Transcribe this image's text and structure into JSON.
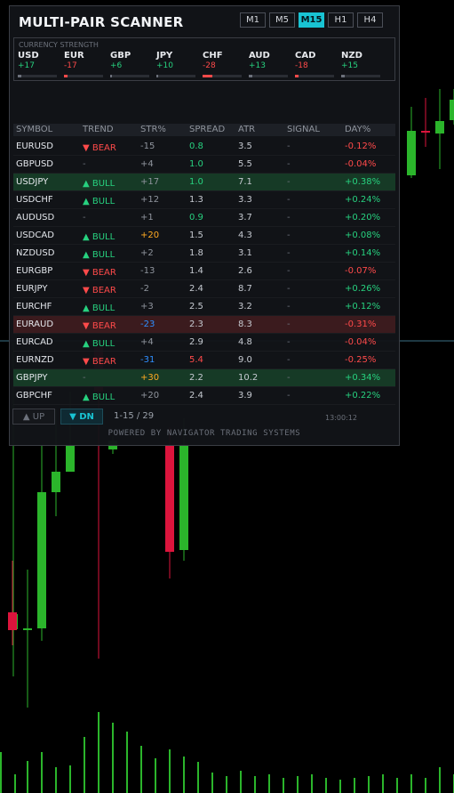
{
  "title": "MULTI-PAIR SCANNER",
  "timeframes": [
    {
      "label": "M1",
      "active": false
    },
    {
      "label": "M5",
      "active": false
    },
    {
      "label": "M15",
      "active": true
    },
    {
      "label": "H1",
      "active": false
    },
    {
      "label": "H4",
      "active": false
    }
  ],
  "currency_strength": {
    "title": "CURRENCY STRENGTH",
    "items": [
      {
        "name": "USD",
        "value": "+17",
        "strength": 0.1,
        "color": "#27d17f"
      },
      {
        "name": "EUR",
        "value": "-17",
        "strength": 0.1,
        "color": "#ff4a4a"
      },
      {
        "name": "GBP",
        "value": "+6",
        "strength": 0.05,
        "color": "#27d17f"
      },
      {
        "name": "JPY",
        "value": "+10",
        "strength": 0.05,
        "color": "#27d17f"
      },
      {
        "name": "CHF",
        "value": "-28",
        "strength": 0.25,
        "color": "#ff4a4a"
      },
      {
        "name": "AUD",
        "value": "+13",
        "strength": 0.1,
        "color": "#27d17f"
      },
      {
        "name": "CAD",
        "value": "-18",
        "strength": 0.1,
        "color": "#ff4a4a"
      },
      {
        "name": "NZD",
        "value": "+15",
        "strength": 0.1,
        "color": "#27d17f"
      }
    ]
  },
  "table": {
    "headers": [
      "SYMBOL",
      "TREND",
      "STR%",
      "SPREAD",
      "ATR",
      "SIGNAL",
      "DAY%"
    ],
    "rows": [
      {
        "symbol": "EURUSD",
        "trend": "▼ BEAR",
        "trend_class": "dn",
        "str": "-15",
        "str_class": "grey",
        "spread": "0.8",
        "spread_class": "green",
        "atr": "3.5",
        "signal": "-",
        "day": "-0.12%",
        "day_class": "red",
        "highlight": ""
      },
      {
        "symbol": "GBPUSD",
        "trend": "-",
        "trend_class": "neu",
        "str": "+4",
        "str_class": "grey",
        "spread": "1.0",
        "spread_class": "green",
        "atr": "5.5",
        "signal": "-",
        "day": "-0.04%",
        "day_class": "red",
        "highlight": ""
      },
      {
        "symbol": "USDJPY",
        "trend": "▲ BULL",
        "trend_class": "up",
        "str": "+17",
        "str_class": "grey",
        "spread": "1.0",
        "spread_class": "green",
        "atr": "7.1",
        "signal": "-",
        "day": "+0.38%",
        "day_class": "green",
        "highlight": "bull"
      },
      {
        "symbol": "USDCHF",
        "trend": "▲ BULL",
        "trend_class": "up",
        "str": "+12",
        "str_class": "grey",
        "spread": "1.3",
        "spread_class": "white",
        "atr": "3.3",
        "signal": "-",
        "day": "+0.24%",
        "day_class": "green",
        "highlight": ""
      },
      {
        "symbol": "AUDUSD",
        "trend": "-",
        "trend_class": "neu",
        "str": "+1",
        "str_class": "grey",
        "spread": "0.9",
        "spread_class": "green",
        "atr": "3.7",
        "signal": "-",
        "day": "+0.20%",
        "day_class": "green",
        "highlight": ""
      },
      {
        "symbol": "USDCAD",
        "trend": "▲ BULL",
        "trend_class": "up",
        "str": "+20",
        "str_class": "orange",
        "spread": "1.5",
        "spread_class": "white",
        "atr": "4.3",
        "signal": "-",
        "day": "+0.08%",
        "day_class": "green",
        "highlight": ""
      },
      {
        "symbol": "NZDUSD",
        "trend": "▲ BULL",
        "trend_class": "up",
        "str": "+2",
        "str_class": "grey",
        "spread": "1.8",
        "spread_class": "white",
        "atr": "3.1",
        "signal": "-",
        "day": "+0.14%",
        "day_class": "green",
        "highlight": ""
      },
      {
        "symbol": "EURGBP",
        "trend": "▼ BEAR",
        "trend_class": "dn",
        "str": "-13",
        "str_class": "grey",
        "spread": "1.4",
        "spread_class": "white",
        "atr": "2.6",
        "signal": "-",
        "day": "-0.07%",
        "day_class": "red",
        "highlight": ""
      },
      {
        "symbol": "EURJPY",
        "trend": "▼ BEAR",
        "trend_class": "dn",
        "str": "-2",
        "str_class": "grey",
        "spread": "2.4",
        "spread_class": "white",
        "atr": "8.7",
        "signal": "-",
        "day": "+0.26%",
        "day_class": "green",
        "highlight": ""
      },
      {
        "symbol": "EURCHF",
        "trend": "▲ BULL",
        "trend_class": "up",
        "str": "+3",
        "str_class": "grey",
        "spread": "2.5",
        "spread_class": "white",
        "atr": "3.2",
        "signal": "-",
        "day": "+0.12%",
        "day_class": "green",
        "highlight": ""
      },
      {
        "symbol": "EURAUD",
        "trend": "▼ BEAR",
        "trend_class": "dn",
        "str": "-23",
        "str_class": "blue",
        "spread": "2.3",
        "spread_class": "white",
        "atr": "8.3",
        "signal": "-",
        "day": "-0.31%",
        "day_class": "red",
        "highlight": "bear"
      },
      {
        "symbol": "EURCAD",
        "trend": "▲ BULL",
        "trend_class": "up",
        "str": "+4",
        "str_class": "grey",
        "spread": "2.9",
        "spread_class": "white",
        "atr": "4.8",
        "signal": "-",
        "day": "-0.04%",
        "day_class": "red",
        "highlight": ""
      },
      {
        "symbol": "EURNZD",
        "trend": "▼ BEAR",
        "trend_class": "dn",
        "str": "-31",
        "str_class": "blue",
        "spread": "5.4",
        "spread_class": "red",
        "atr": "9.0",
        "signal": "-",
        "day": "-0.25%",
        "day_class": "red",
        "highlight": ""
      },
      {
        "symbol": "GBPJPY",
        "trend": "-",
        "trend_class": "neu",
        "str": "+30",
        "str_class": "orange",
        "spread": "2.2",
        "spread_class": "white",
        "atr": "10.2",
        "signal": "-",
        "day": "+0.34%",
        "day_class": "green",
        "highlight": "bull"
      },
      {
        "symbol": "GBPCHF",
        "trend": "▲ BULL",
        "trend_class": "up",
        "str": "+20",
        "str_class": "grey",
        "spread": "2.4",
        "spread_class": "white",
        "atr": "3.9",
        "signal": "-",
        "day": "+0.22%",
        "day_class": "green",
        "highlight": ""
      }
    ]
  },
  "footer": {
    "up_button": "▲ UP",
    "dn_button": "▼ DN",
    "pager": "1-15 / 29",
    "clock": "13:00:12",
    "powered": "POWERED BY NAVIGATOR TRADING SYSTEMS"
  },
  "colors": {
    "accent": "#19c3d3",
    "bull": "#27d17f",
    "bear": "#ff4a4a",
    "candle_up": "#2bb52b",
    "candle_down": "#dc143c"
  }
}
